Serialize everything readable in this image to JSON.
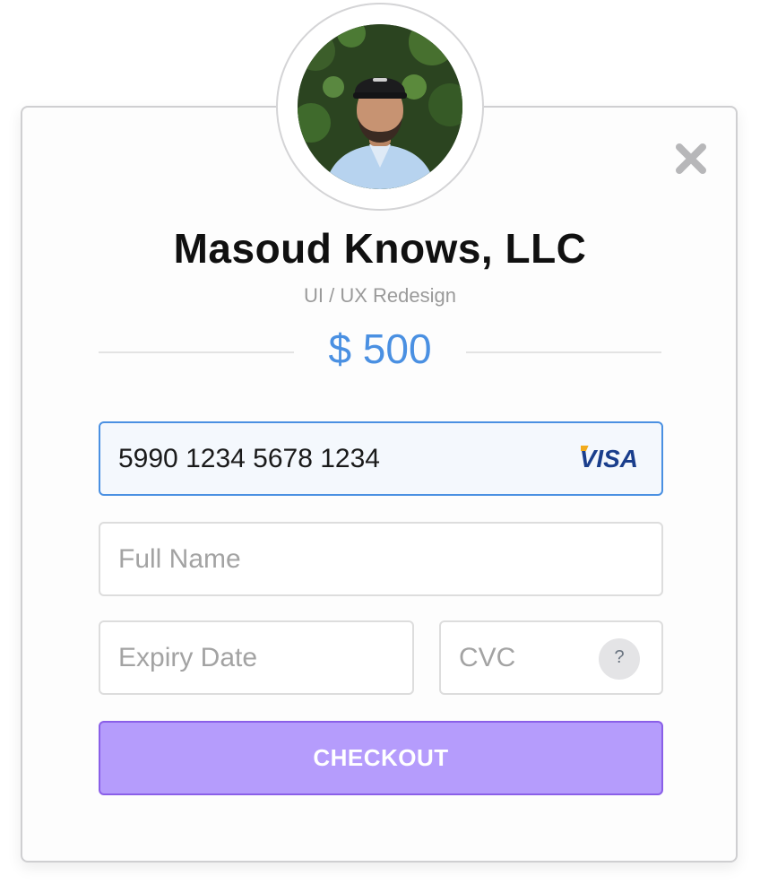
{
  "header": {
    "company_name": "Masoud Knows, LLC",
    "project_name": "UI / UX Redesign",
    "amount": "$ 500"
  },
  "form": {
    "card_number": {
      "value": "5990 1234 5678 1234",
      "placeholder": ""
    },
    "card_brand": "VISA",
    "full_name": {
      "value": "",
      "placeholder": "Full Name"
    },
    "expiry_date": {
      "value": "",
      "placeholder": "Expiry Date"
    },
    "cvc": {
      "value": "",
      "placeholder": "CVC"
    },
    "cvc_help_label": "?",
    "checkout_label": "CHECKOUT"
  },
  "icons": {
    "close": "close-icon",
    "help": "question-icon",
    "card_brand": "visa-logo"
  },
  "colors": {
    "accent_blue": "#4a90e2",
    "checkout_fill": "#b59cfc",
    "checkout_border": "#8a5fe8",
    "visa_blue": "#1a3e8c",
    "visa_gold": "#f2ab1c"
  }
}
